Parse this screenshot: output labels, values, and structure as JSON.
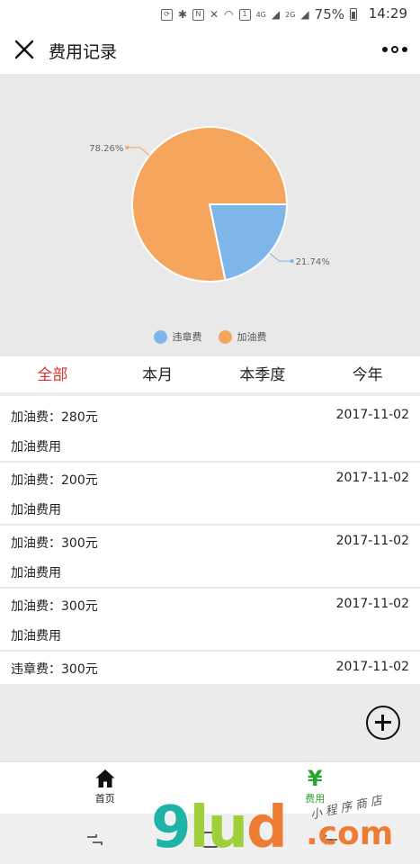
{
  "status_bar": {
    "network_label": "4G",
    "network_label2": "2G",
    "battery": "75%",
    "time": "14:29"
  },
  "navbar": {
    "title": "费用记录",
    "close_icon": "close-icon",
    "more_icon": "more-icon"
  },
  "chart_data": {
    "type": "pie",
    "slices": [
      {
        "name": "违章费",
        "value": 21.74,
        "label": "21.74%",
        "color": "#7fb6ea"
      },
      {
        "name": "加油费",
        "value": 78.26,
        "label": "78.26%",
        "color": "#f5a55c"
      }
    ],
    "legend_position": "bottom"
  },
  "tabs": [
    {
      "label": "全部",
      "active": true
    },
    {
      "label": "本月",
      "active": false
    },
    {
      "label": "本季度",
      "active": false
    },
    {
      "label": "今年",
      "active": false
    }
  ],
  "records": [
    {
      "title": "加油费：280元",
      "date": "2017-11-02",
      "desc": "加油费用"
    },
    {
      "title": "加油费：200元",
      "date": "2017-11-02",
      "desc": "加油费用"
    },
    {
      "title": "加油费：300元",
      "date": "2017-11-02",
      "desc": "加油费用"
    },
    {
      "title": "加油费：300元",
      "date": "2017-11-02",
      "desc": "加油费用"
    },
    {
      "title": "违章费：300元",
      "date": "2017-11-02",
      "desc": ""
    }
  ],
  "add_button": {
    "icon": "plus-circle-icon"
  },
  "tabbar": [
    {
      "label": "首页",
      "icon": "home-icon",
      "active": false
    },
    {
      "label": "费用",
      "icon": "yen-icon",
      "glyph": "¥",
      "active": true
    }
  ],
  "watermark": {
    "brand_a": "9",
    "brand_b": "lu",
    "brand_c": "d",
    "brand_suffix": ".com",
    "tagline": "小程序商店"
  },
  "colors": {
    "accent_red": "#e0312f",
    "accent_green": "#2aa42e",
    "pie_blue": "#7fb6ea",
    "pie_orange": "#f5a55c"
  }
}
